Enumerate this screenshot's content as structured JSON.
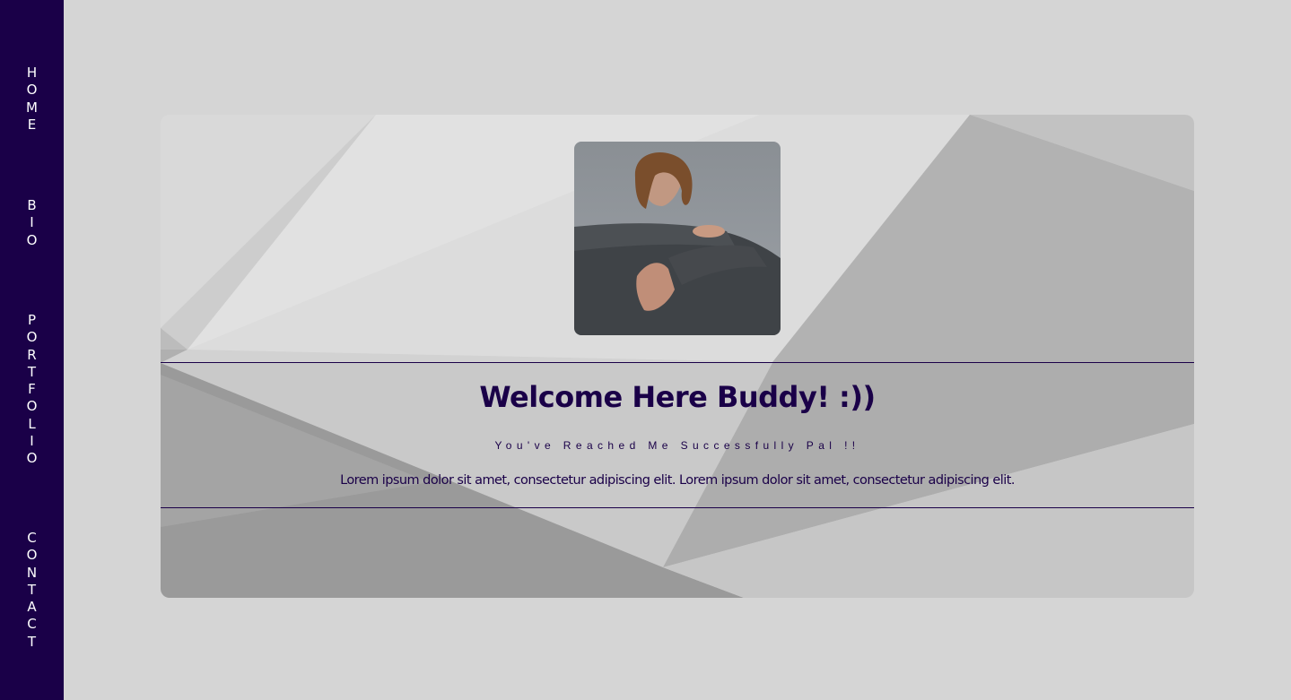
{
  "sidebar": {
    "items": [
      {
        "label": "HOME"
      },
      {
        "label": "BIO"
      },
      {
        "label": "PORTFOLIO"
      },
      {
        "label": "CONTACT"
      }
    ]
  },
  "hero": {
    "title": "Welcome Here Buddy! :))",
    "subtitle": "You've Reached Me Successfully Pal !!",
    "body": "Lorem ipsum dolor sit amet, consectetur adipiscing elit. Lorem ipsum dolor sit amet, consectetur adipiscing elit."
  },
  "colors": {
    "sidebar_bg": "#1a0048",
    "accent_text": "#1a0048",
    "page_bg": "#d5d5d5"
  }
}
